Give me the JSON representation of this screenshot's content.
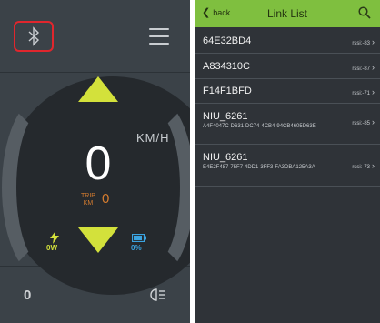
{
  "dashboard": {
    "speed": "0",
    "speed_unit": "KM/H",
    "trip_label_line1": "TRIP",
    "trip_label_line2": "KM",
    "trip_value": "0",
    "power": "0W",
    "battery": "0%",
    "odometer": "0",
    "icons": [
      "bluetooth-icon",
      "menu-icon",
      "lightning-icon",
      "battery-icon",
      "headlight-icon"
    ],
    "colors": {
      "accent": "#d3e13b",
      "trip": "#d57c2f",
      "battery": "#3ba3e0",
      "highlight_box": "#e0262d"
    }
  },
  "link_list": {
    "back_label": "back",
    "title": "Link List",
    "header_color": "#7fbf3f",
    "devices": [
      {
        "name": "64E32BD4",
        "uuid": "",
        "rssi": "rssi:-83"
      },
      {
        "name": "A834310C",
        "uuid": "",
        "rssi": "rssi:-87"
      },
      {
        "name": "F14F1BFD",
        "uuid": "",
        "rssi": "rssi:-71"
      },
      {
        "name": "NIU_6261",
        "uuid": "A4F4047C-D631-DC74-4CB4-94CB4605D63E",
        "rssi": "rssi:-85"
      },
      {
        "name": "NIU_6261",
        "uuid": "E4E2F487-75F7-4DD1-3FF3-FA3DBA125A3A",
        "rssi": "rssi:-73"
      }
    ]
  }
}
